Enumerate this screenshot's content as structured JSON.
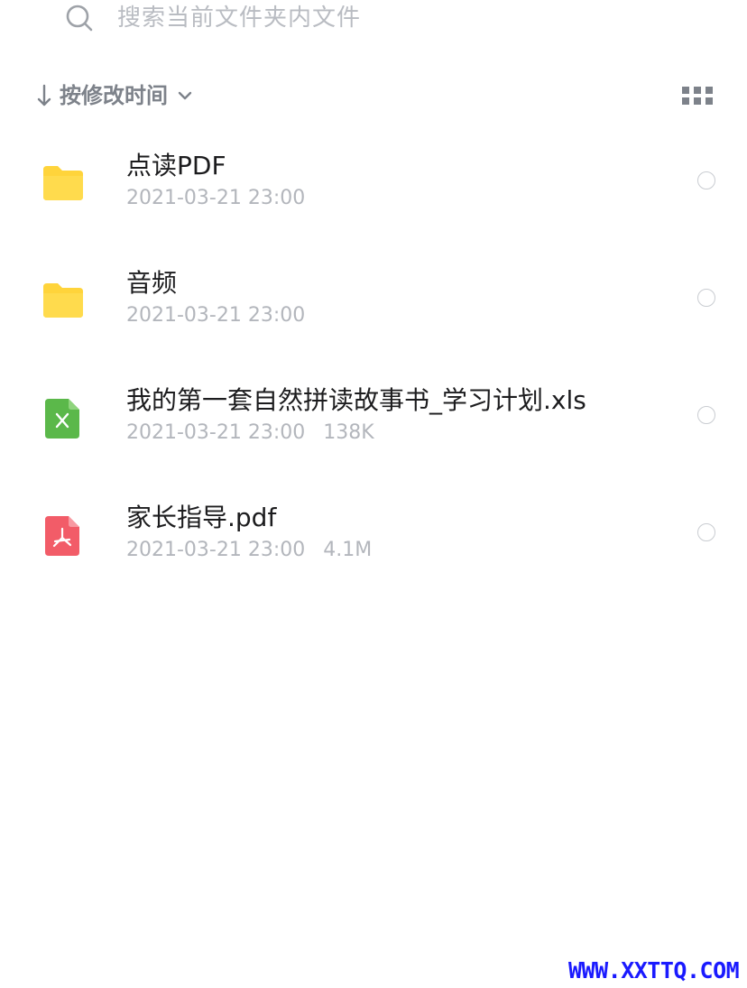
{
  "search": {
    "placeholder": "搜索当前文件夹内文件",
    "icon": "search-icon"
  },
  "sort": {
    "label": "按修改时间",
    "arrow_icon": "arrow-down-icon",
    "dropdown_icon": "chevron-down-icon"
  },
  "view_toggle": {
    "icon": "grid-view-icon"
  },
  "files": [
    {
      "name": "点读PDF",
      "date": "2021-03-21 23:00",
      "size": "",
      "type": "folder",
      "icon": "folder-icon"
    },
    {
      "name": "音频",
      "date": "2021-03-21 23:00",
      "size": "",
      "type": "folder",
      "icon": "folder-icon"
    },
    {
      "name": "我的第一套自然拼读故事书_学习计划.xls",
      "date": "2021-03-21 23:00",
      "size": "138K",
      "type": "xls",
      "icon": "excel-file-icon"
    },
    {
      "name": "家长指导.pdf",
      "date": "2021-03-21 23:00",
      "size": "4.1M",
      "type": "pdf",
      "icon": "pdf-file-icon"
    }
  ],
  "watermark": {
    "text": "WWW.XXTTQ.COM"
  },
  "colors": {
    "folder": "#ffd43b",
    "excel": "#5bb84a",
    "pdf": "#f25c68",
    "watermark": "#1a1aff",
    "meta_text": "#b3b6bc"
  }
}
